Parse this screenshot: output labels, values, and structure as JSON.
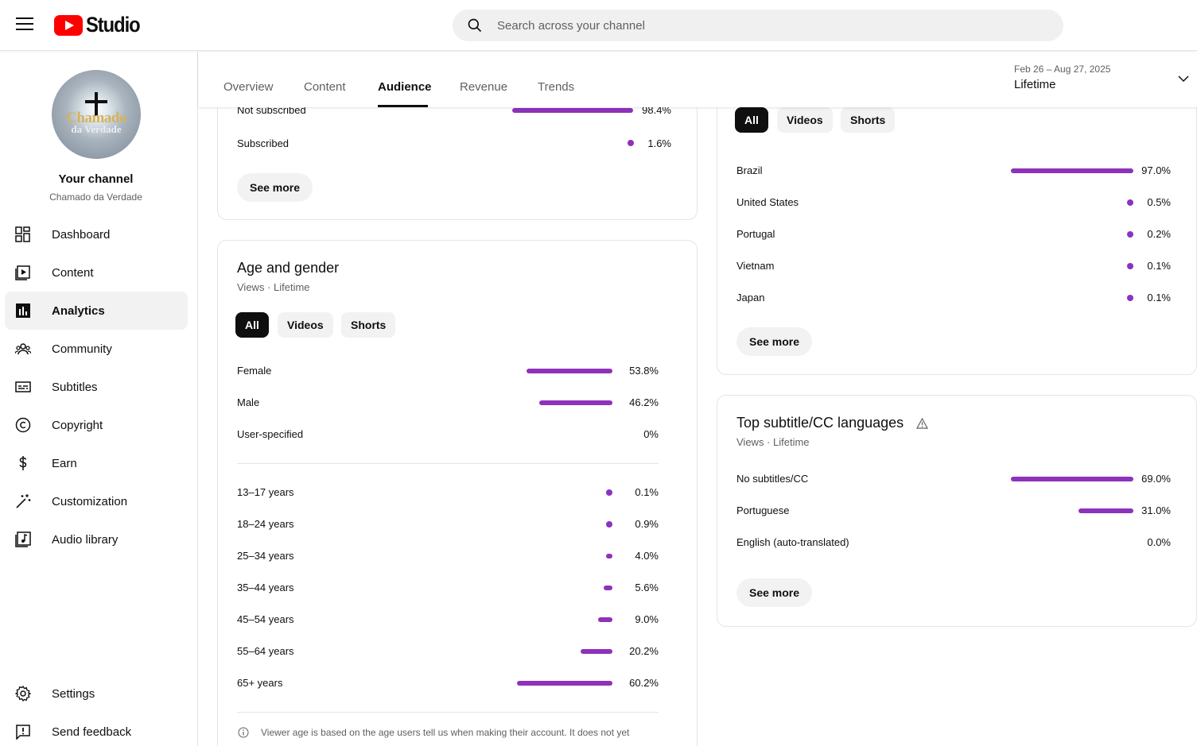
{
  "app": {
    "name": "Studio"
  },
  "search": {
    "placeholder": "Search across your channel"
  },
  "channel": {
    "title": "Your channel",
    "name": "Chamado da Verdade",
    "avatar_text_1": "Chamado",
    "avatar_text_2": "da Verdade"
  },
  "sidebar": {
    "items": [
      {
        "label": "Dashboard",
        "icon": "dashboard-icon"
      },
      {
        "label": "Content",
        "icon": "content-icon"
      },
      {
        "label": "Analytics",
        "icon": "analytics-icon",
        "active": true
      },
      {
        "label": "Community",
        "icon": "community-icon"
      },
      {
        "label": "Subtitles",
        "icon": "subtitles-icon"
      },
      {
        "label": "Copyright",
        "icon": "copyright-icon"
      },
      {
        "label": "Earn",
        "icon": "earn-icon"
      },
      {
        "label": "Customization",
        "icon": "customization-icon"
      },
      {
        "label": "Audio library",
        "icon": "audio-library-icon"
      }
    ],
    "settings": "Settings",
    "feedback": "Send feedback"
  },
  "tabs": [
    "Overview",
    "Content",
    "Audience",
    "Revenue",
    "Trends"
  ],
  "active_tab": "Audience",
  "date_range": {
    "range": "Feb 26 – Aug 27, 2025",
    "label": "Lifetime"
  },
  "subscription_card": {
    "rows": [
      {
        "label": "Not subscribed",
        "value": "98.4%"
      },
      {
        "label": "Subscribed",
        "value": "1.6%"
      }
    ],
    "see_more": "See more"
  },
  "age_gender": {
    "title": "Age and gender",
    "subtitle": "Views · Lifetime",
    "chips": [
      "All",
      "Videos",
      "Shorts"
    ],
    "gender": [
      {
        "label": "Female",
        "value": "53.8%",
        "fraction": 0.538
      },
      {
        "label": "Male",
        "value": "46.2%",
        "fraction": 0.462
      },
      {
        "label": "User-specified",
        "value": "0%",
        "fraction": 0
      }
    ],
    "ages": [
      {
        "label": "13–17 years",
        "value": "0.1%",
        "fraction": 0.001
      },
      {
        "label": "18–24 years",
        "value": "0.9%",
        "fraction": 0.009
      },
      {
        "label": "25–34 years",
        "value": "4.0%",
        "fraction": 0.04
      },
      {
        "label": "35–44 years",
        "value": "5.6%",
        "fraction": 0.056
      },
      {
        "label": "45–54 years",
        "value": "9.0%",
        "fraction": 0.09
      },
      {
        "label": "55–64 years",
        "value": "20.2%",
        "fraction": 0.202
      },
      {
        "label": "65+ years",
        "value": "60.2%",
        "fraction": 0.602
      }
    ],
    "footnote": "Viewer age is based on the age users tell us when making their account. It does not yet"
  },
  "geography": {
    "chips": [
      "All",
      "Videos",
      "Shorts"
    ],
    "rows": [
      {
        "label": "Brazil",
        "value": "97.0%",
        "fraction": 0.97
      },
      {
        "label": "United States",
        "value": "0.5%",
        "fraction": 0.005
      },
      {
        "label": "Portugal",
        "value": "0.2%",
        "fraction": 0.002
      },
      {
        "label": "Vietnam",
        "value": "0.1%",
        "fraction": 0.001
      },
      {
        "label": "Japan",
        "value": "0.1%",
        "fraction": 0.001
      }
    ],
    "see_more": "See more"
  },
  "subtitles": {
    "title": "Top subtitle/CC languages",
    "subtitle": "Views · Lifetime",
    "rows": [
      {
        "label": "No subtitles/CC",
        "value": "69.0%",
        "fraction": 0.69
      },
      {
        "label": "Portuguese",
        "value": "31.0%",
        "fraction": 0.31
      },
      {
        "label": "English (auto-translated)",
        "value": "0.0%",
        "fraction": 0
      }
    ],
    "see_more": "See more"
  },
  "colors": {
    "accent": "#8e31bb",
    "chip_active": "#0f0f0f",
    "logo_red": "#ff0000"
  }
}
